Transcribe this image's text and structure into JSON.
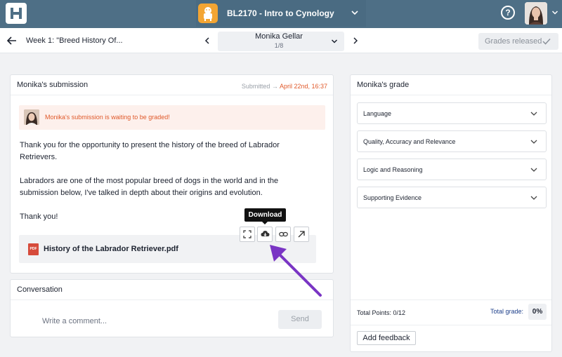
{
  "header": {
    "course_title": "BL2170 - Intro to Cynology",
    "help_label": "?"
  },
  "subheader": {
    "assignment_title": "Week 1: \"Breed History Of...",
    "student_name": "Monika Gellar",
    "student_position": "1/8",
    "grades_released_label": "Grades released"
  },
  "submission": {
    "title": "Monika's submission",
    "submitted_label": "Submitted",
    "submitted_date": "April 22nd, 16:37",
    "waiting_message": "Monika's submission is waiting to be graded!",
    "paragraphs": [
      "Thank you for the opportunity to present the history of the breed of Labrador Retrievers.",
      "Labradors are one of the most popular breed of dogs in the world and in the submission below, I've talked in depth about their origins and evolution.",
      "Thank you!"
    ],
    "attachment": {
      "badge": "PDF",
      "name": "History of the Labrador Retriever.pdf"
    },
    "tooltip": "Download",
    "actions": [
      "fullscreen-icon",
      "download-icon",
      "link-icon",
      "open-external-icon"
    ]
  },
  "conversation": {
    "title": "Conversation",
    "comment_placeholder": "Write a comment...",
    "send_label": "Send"
  },
  "grade": {
    "title": "Monika's grade",
    "criteria": [
      "Language",
      "Quality, Accuracy and Relevance",
      "Logic and Reasoning",
      "Supporting Evidence"
    ],
    "total_points": "Total Points: 0/12",
    "total_grade_label": "Total grade:",
    "total_grade_value": "0%",
    "add_feedback_label": "Add feedback"
  },
  "colors": {
    "topbar": "#4e6f86",
    "accent_orange": "#e0592a",
    "annotation_arrow": "#7a35c4"
  }
}
